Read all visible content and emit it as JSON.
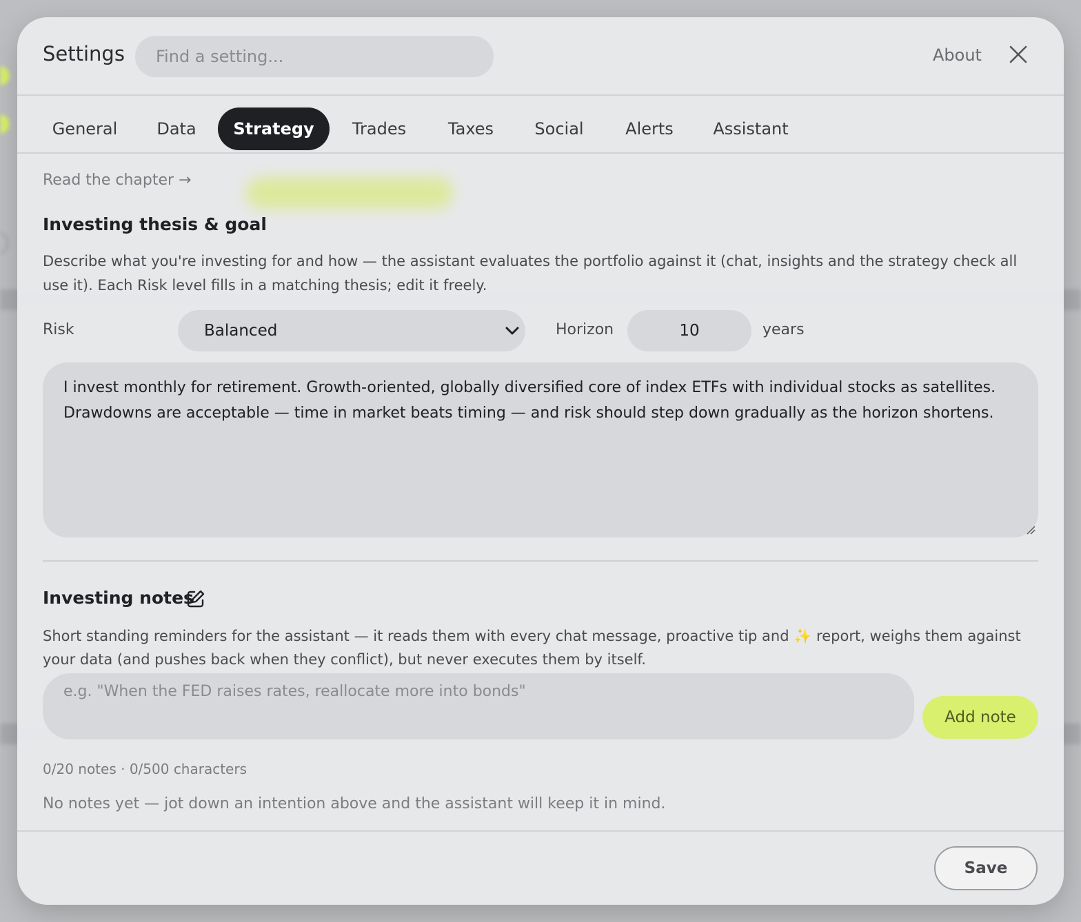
{
  "header": {
    "title": "Settings",
    "search_placeholder": "Find a setting...",
    "about_label": "About"
  },
  "tabs": [
    {
      "label": "General",
      "active": false
    },
    {
      "label": "Data",
      "active": false
    },
    {
      "label": "Strategy",
      "active": true
    },
    {
      "label": "Trades",
      "active": false
    },
    {
      "label": "Taxes",
      "active": false
    },
    {
      "label": "Social",
      "active": false
    },
    {
      "label": "Alerts",
      "active": false
    },
    {
      "label": "Assistant",
      "active": false
    }
  ],
  "strategy": {
    "read_link": "Read the chapter →",
    "thesis_heading": "Investing thesis & goal",
    "thesis_description": "Describe what you're investing for and how — the assistant evaluates the portfolio against it (chat, insights and the strategy check all use it). Each Risk level fills in a matching thesis; edit it freely.",
    "risk_label": "Risk",
    "risk_value": "Balanced",
    "horizon_label": "Horizon",
    "horizon_value": "10",
    "horizon_unit": "years",
    "thesis_text": "I invest monthly for retirement. Growth-oriented, globally diversified core of index ETFs with individual stocks as satellites. Drawdowns are acceptable — time in market beats timing — and risk should step down gradually as the horizon shortens.",
    "notes_heading": "Investing notes",
    "notes_description": "Short standing reminders for the assistant — it reads them with every chat message, proactive tip and ✨ report, weighs them against your data (and pushes back when they conflict), but never executes them by itself.",
    "note_placeholder": "e.g. \"When the FED raises rates, reallocate more into bonds\"",
    "add_note_label": "Add note",
    "counter": "0/20 notes · 0/500 characters",
    "empty_state": "No notes yet — jot down an intention above and the assistant will keep it in mind."
  },
  "footer": {
    "save_label": "Save"
  },
  "colors": {
    "accent": "#d9ef6e",
    "active_tab": "#1f2024"
  }
}
